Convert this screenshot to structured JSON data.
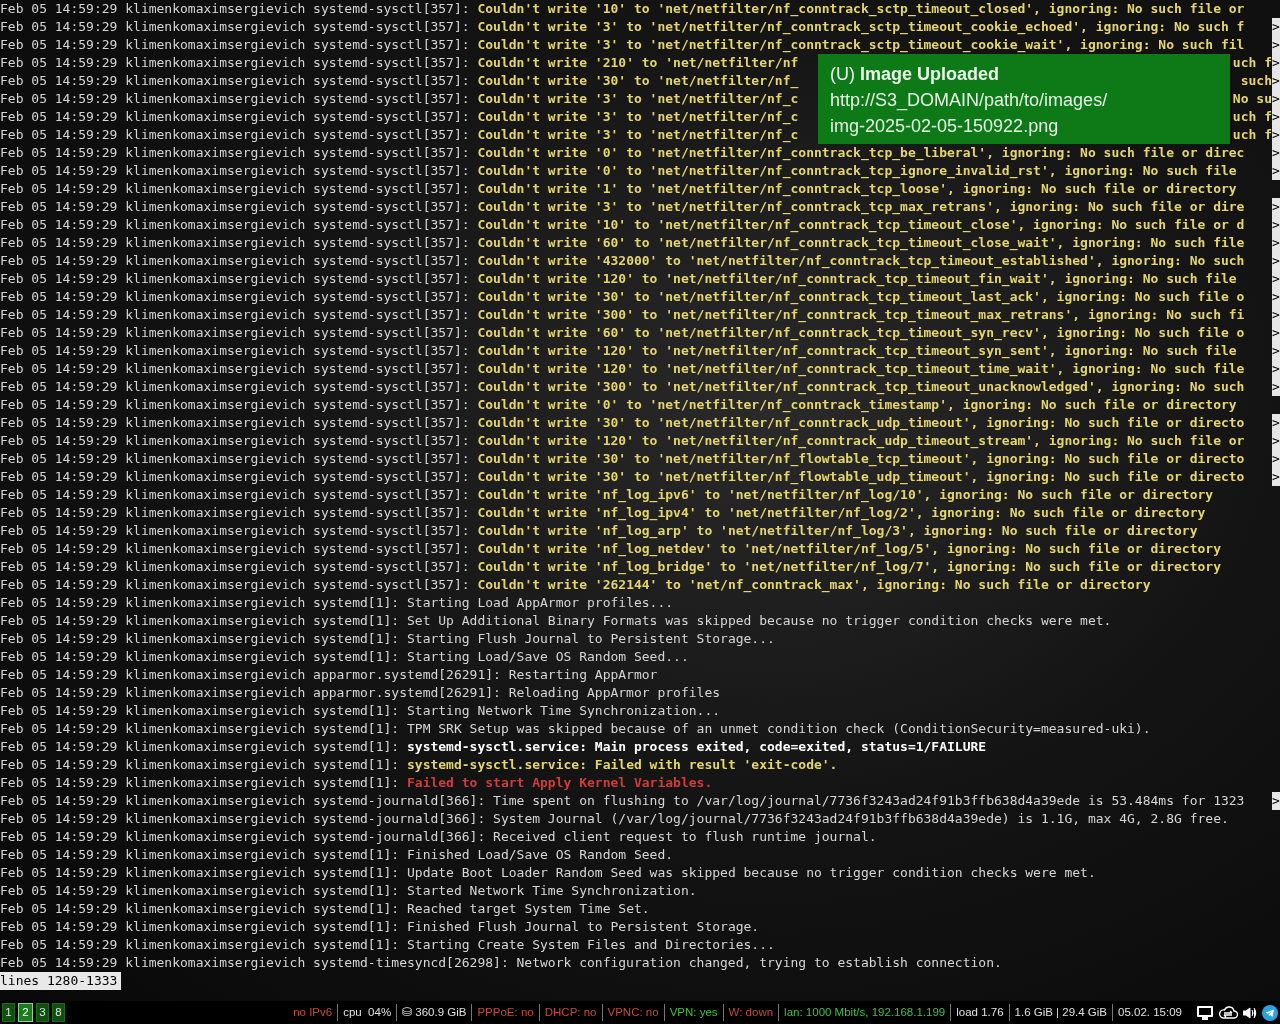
{
  "terminal": {
    "lines": [
      {
        "prefix": "Feb 05 14:59:29 klimenkomaximsergievich systemd-sysctl[357]:",
        "message": "Couldn't write '10' to 'net/netfilter/nf_conntrack_sctp_timeout_closed', ignoring: No such file or",
        "kind": "warning"
      },
      {
        "prefix": "Feb 05 14:59:29 klimenkomaximsergievich systemd-sysctl[357]:",
        "message": "Couldn't write '3' to 'net/netfilter/nf_conntrack_sctp_timeout_cookie_echoed', ignoring: No such f",
        "kind": "warning",
        "marker": ">"
      },
      {
        "prefix": "Feb 05 14:59:29 klimenkomaximsergievich systemd-sysctl[357]:",
        "message": "Couldn't write '3' to 'net/netfilter/nf_conntrack_sctp_timeout_cookie_wait', ignoring: No such fil",
        "kind": "warning",
        "marker": ">"
      },
      {
        "prefix": "Feb 05 14:59:29 klimenkomaximsergievich systemd-sysctl[357]:",
        "message": "Couldn't write '210' to 'net/netfilter/nf",
        "message_end": "uch f",
        "kind": "warning",
        "marker": ">"
      },
      {
        "prefix": "Feb 05 14:59:29 klimenkomaximsergievich systemd-sysctl[357]:",
        "message": "Couldn't write '30' to 'net/netfilter/nf_",
        "message_end": "such",
        "kind": "warning",
        "marker": ">"
      },
      {
        "prefix": "Feb 05 14:59:29 klimenkomaximsergievich systemd-sysctl[357]:",
        "message": "Couldn't write '3' to 'net/netfilter/nf_c",
        "message_end": "No su",
        "kind": "warning",
        "marker": ">"
      },
      {
        "prefix": "Feb 05 14:59:29 klimenkomaximsergievich systemd-sysctl[357]:",
        "message": "Couldn't write '3' to 'net/netfilter/nf_c",
        "message_end": "uch f",
        "kind": "warning",
        "marker": ">"
      },
      {
        "prefix": "Feb 05 14:59:29 klimenkomaximsergievich systemd-sysctl[357]:",
        "message": "Couldn't write '3' to 'net/netfilter/nf_c",
        "message_end": "uch f",
        "kind": "warning",
        "marker": ">"
      },
      {
        "prefix": "Feb 05 14:59:29 klimenkomaximsergievich systemd-sysctl[357]:",
        "message": "Couldn't write '0' to 'net/netfilter/nf_conntrack_tcp_be_liberal', ignoring: No such file or direc",
        "kind": "warning",
        "marker": ">"
      },
      {
        "prefix": "Feb 05 14:59:29 klimenkomaximsergievich systemd-sysctl[357]:",
        "message": "Couldn't write '0' to 'net/netfilter/nf_conntrack_tcp_ignore_invalid_rst', ignoring: No such file",
        "kind": "warning",
        "marker": ">"
      },
      {
        "prefix": "Feb 05 14:59:29 klimenkomaximsergievich systemd-sysctl[357]:",
        "message": "Couldn't write '1' to 'net/netfilter/nf_conntrack_tcp_loose', ignoring: No such file or directory",
        "kind": "warning"
      },
      {
        "prefix": "Feb 05 14:59:29 klimenkomaximsergievich systemd-sysctl[357]:",
        "message": "Couldn't write '3' to 'net/netfilter/nf_conntrack_tcp_max_retrans', ignoring: No such file or dire",
        "kind": "warning",
        "marker": ">"
      },
      {
        "prefix": "Feb 05 14:59:29 klimenkomaximsergievich systemd-sysctl[357]:",
        "message": "Couldn't write '10' to 'net/netfilter/nf_conntrack_tcp_timeout_close', ignoring: No such file or d",
        "kind": "warning",
        "marker": ">"
      },
      {
        "prefix": "Feb 05 14:59:29 klimenkomaximsergievich systemd-sysctl[357]:",
        "message": "Couldn't write '60' to 'net/netfilter/nf_conntrack_tcp_timeout_close_wait', ignoring: No such file",
        "kind": "warning",
        "marker": ">"
      },
      {
        "prefix": "Feb 05 14:59:29 klimenkomaximsergievich systemd-sysctl[357]:",
        "message": "Couldn't write '432000' to 'net/netfilter/nf_conntrack_tcp_timeout_established', ignoring: No such",
        "kind": "warning",
        "marker": ">"
      },
      {
        "prefix": "Feb 05 14:59:29 klimenkomaximsergievich systemd-sysctl[357]:",
        "message": "Couldn't write '120' to 'net/netfilter/nf_conntrack_tcp_timeout_fin_wait', ignoring: No such file",
        "kind": "warning",
        "marker": ">"
      },
      {
        "prefix": "Feb 05 14:59:29 klimenkomaximsergievich systemd-sysctl[357]:",
        "message": "Couldn't write '30' to 'net/netfilter/nf_conntrack_tcp_timeout_last_ack', ignoring: No such file o",
        "kind": "warning",
        "marker": ">"
      },
      {
        "prefix": "Feb 05 14:59:29 klimenkomaximsergievich systemd-sysctl[357]:",
        "message": "Couldn't write '300' to 'net/netfilter/nf_conntrack_tcp_timeout_max_retrans', ignoring: No such fi",
        "kind": "warning",
        "marker": ">"
      },
      {
        "prefix": "Feb 05 14:59:29 klimenkomaximsergievich systemd-sysctl[357]:",
        "message": "Couldn't write '60' to 'net/netfilter/nf_conntrack_tcp_timeout_syn_recv', ignoring: No such file o",
        "kind": "warning",
        "marker": ">"
      },
      {
        "prefix": "Feb 05 14:59:29 klimenkomaximsergievich systemd-sysctl[357]:",
        "message": "Couldn't write '120' to 'net/netfilter/nf_conntrack_tcp_timeout_syn_sent', ignoring: No such file",
        "kind": "warning",
        "marker": ">"
      },
      {
        "prefix": "Feb 05 14:59:29 klimenkomaximsergievich systemd-sysctl[357]:",
        "message": "Couldn't write '120' to 'net/netfilter/nf_conntrack_tcp_timeout_time_wait', ignoring: No such file",
        "kind": "warning",
        "marker": ">"
      },
      {
        "prefix": "Feb 05 14:59:29 klimenkomaximsergievich systemd-sysctl[357]:",
        "message": "Couldn't write '300' to 'net/netfilter/nf_conntrack_tcp_timeout_unacknowledged', ignoring: No such",
        "kind": "warning",
        "marker": ">"
      },
      {
        "prefix": "Feb 05 14:59:29 klimenkomaximsergievich systemd-sysctl[357]:",
        "message": "Couldn't write '0' to 'net/netfilter/nf_conntrack_timestamp', ignoring: No such file or directory",
        "kind": "warning"
      },
      {
        "prefix": "Feb 05 14:59:29 klimenkomaximsergievich systemd-sysctl[357]:",
        "message": "Couldn't write '30' to 'net/netfilter/nf_conntrack_udp_timeout', ignoring: No such file or directo",
        "kind": "warning",
        "marker": ">"
      },
      {
        "prefix": "Feb 05 14:59:29 klimenkomaximsergievich systemd-sysctl[357]:",
        "message": "Couldn't write '120' to 'net/netfilter/nf_conntrack_udp_timeout_stream', ignoring: No such file or",
        "kind": "warning",
        "marker": ">"
      },
      {
        "prefix": "Feb 05 14:59:29 klimenkomaximsergievich systemd-sysctl[357]:",
        "message": "Couldn't write '30' to 'net/netfilter/nf_flowtable_tcp_timeout', ignoring: No such file or directo",
        "kind": "warning",
        "marker": ">"
      },
      {
        "prefix": "Feb 05 14:59:29 klimenkomaximsergievich systemd-sysctl[357]:",
        "message": "Couldn't write '30' to 'net/netfilter/nf_flowtable_udp_timeout', ignoring: No such file or directo",
        "kind": "warning",
        "marker": ">"
      },
      {
        "prefix": "Feb 05 14:59:29 klimenkomaximsergievich systemd-sysctl[357]:",
        "message": "Couldn't write 'nf_log_ipv6' to 'net/netfilter/nf_log/10', ignoring: No such file or directory",
        "kind": "warning"
      },
      {
        "prefix": "Feb 05 14:59:29 klimenkomaximsergievich systemd-sysctl[357]:",
        "message": "Couldn't write 'nf_log_ipv4' to 'net/netfilter/nf_log/2', ignoring: No such file or directory",
        "kind": "warning"
      },
      {
        "prefix": "Feb 05 14:59:29 klimenkomaximsergievich systemd-sysctl[357]:",
        "message": "Couldn't write 'nf_log_arp' to 'net/netfilter/nf_log/3', ignoring: No such file or directory",
        "kind": "warning"
      },
      {
        "prefix": "Feb 05 14:59:29 klimenkomaximsergievich systemd-sysctl[357]:",
        "message": "Couldn't write 'nf_log_netdev' to 'net/netfilter/nf_log/5', ignoring: No such file or directory",
        "kind": "warning"
      },
      {
        "prefix": "Feb 05 14:59:29 klimenkomaximsergievich systemd-sysctl[357]:",
        "message": "Couldn't write 'nf_log_bridge' to 'net/netfilter/nf_log/7', ignoring: No such file or directory",
        "kind": "warning"
      },
      {
        "prefix": "Feb 05 14:59:29 klimenkomaximsergievich systemd-sysctl[357]:",
        "message": "Couldn't write '262144' to 'net/nf_conntrack_max', ignoring: No such file or directory",
        "kind": "warning"
      },
      {
        "prefix": "Feb 05 14:59:29 klimenkomaximsergievich systemd[1]:",
        "message": "Starting Load AppArmor profiles...",
        "kind": "info"
      },
      {
        "prefix": "Feb 05 14:59:29 klimenkomaximsergievich systemd[1]:",
        "message": "Set Up Additional Binary Formats was skipped because no trigger condition checks were met.",
        "kind": "info"
      },
      {
        "prefix": "Feb 05 14:59:29 klimenkomaximsergievich systemd[1]:",
        "message": "Starting Flush Journal to Persistent Storage...",
        "kind": "info"
      },
      {
        "prefix": "Feb 05 14:59:29 klimenkomaximsergievich systemd[1]:",
        "message": "Starting Load/Save OS Random Seed...",
        "kind": "info"
      },
      {
        "prefix": "Feb 05 14:59:29 klimenkomaximsergievich apparmor.systemd[26291]:",
        "message": "Restarting AppArmor",
        "kind": "info"
      },
      {
        "prefix": "Feb 05 14:59:29 klimenkomaximsergievich apparmor.systemd[26291]:",
        "message": "Reloading AppArmor profiles",
        "kind": "info"
      },
      {
        "prefix": "Feb 05 14:59:29 klimenkomaximsergievich systemd[1]:",
        "message": "Starting Network Time Synchronization...",
        "kind": "info"
      },
      {
        "prefix": "Feb 05 14:59:29 klimenkomaximsergievich systemd[1]:",
        "message": "TPM SRK Setup was skipped because of an unmet condition check (ConditionSecurity=measured-uki).",
        "kind": "info"
      },
      {
        "prefix": "Feb 05 14:59:29 klimenkomaximsergievich systemd[1]:",
        "message": "systemd-sysctl.service: Main process exited, code=exited, status=1/FAILURE",
        "kind": "notice"
      },
      {
        "prefix": "Feb 05 14:59:29 klimenkomaximsergievich systemd[1]:",
        "message": "systemd-sysctl.service: Failed with result 'exit-code'.",
        "kind": "warning"
      },
      {
        "prefix": "Feb 05 14:59:29 klimenkomaximsergievich systemd[1]:",
        "message": "Failed to start Apply Kernel Variables.",
        "kind": "error"
      },
      {
        "prefix": "Feb 05 14:59:29 klimenkomaximsergievich systemd-journald[366]:",
        "message": "Time spent on flushing to /var/log/journal/7736f3243ad24f91b3ffb638d4a39ede is 53.484ms for 1323",
        "kind": "info",
        "marker": ">"
      },
      {
        "prefix": "Feb 05 14:59:29 klimenkomaximsergievich systemd-journald[366]:",
        "message": "System Journal (/var/log/journal/7736f3243ad24f91b3ffb638d4a39ede) is 1.1G, max 4G, 2.8G free.",
        "kind": "info"
      },
      {
        "prefix": "Feb 05 14:59:29 klimenkomaximsergievich systemd-journald[366]:",
        "message": "Received client request to flush runtime journal.",
        "kind": "info"
      },
      {
        "prefix": "Feb 05 14:59:29 klimenkomaximsergievich systemd[1]:",
        "message": "Finished Load/Save OS Random Seed.",
        "kind": "info"
      },
      {
        "prefix": "Feb 05 14:59:29 klimenkomaximsergievich systemd[1]:",
        "message": "Update Boot Loader Random Seed was skipped because no trigger condition checks were met.",
        "kind": "info"
      },
      {
        "prefix": "Feb 05 14:59:29 klimenkomaximsergievich systemd[1]:",
        "message": "Started Network Time Synchronization.",
        "kind": "info"
      },
      {
        "prefix": "Feb 05 14:59:29 klimenkomaximsergievich systemd[1]:",
        "message": "Reached target System Time Set.",
        "kind": "info"
      },
      {
        "prefix": "Feb 05 14:59:29 klimenkomaximsergievich systemd[1]:",
        "message": "Finished Flush Journal to Persistent Storage.",
        "kind": "info"
      },
      {
        "prefix": "Feb 05 14:59:29 klimenkomaximsergievich systemd[1]:",
        "message": "Starting Create System Files and Directories...",
        "kind": "info"
      },
      {
        "prefix": "Feb 05 14:59:29 klimenkomaximsergievich systemd-timesyncd[26298]:",
        "message": "Network configuration changed, trying to establish connection.",
        "kind": "info"
      }
    ],
    "pager_status": "lines 1280-1333"
  },
  "notification": {
    "title": "(U) **Image Uploaded**",
    "body": [
      "http://S3_DOMAIN/path/to/images/",
      "img-2025-02-05-150922.png"
    ]
  },
  "status_bar": {
    "workspaces": [
      {
        "label": "1",
        "selected": false
      },
      {
        "label": "2",
        "selected": true
      },
      {
        "label": "3",
        "selected": false
      },
      {
        "label": "8",
        "selected": false
      }
    ],
    "items": [
      {
        "text": "no IPv6",
        "color": "#c84a3a"
      },
      {
        "text": "cpu  04%",
        "color": "#e0e0e0"
      },
      {
        "text": "⛁ 360.9 GiB",
        "color": "#e0e0e0"
      },
      {
        "text": "PPPoE: no",
        "color": "#c84a3a"
      },
      {
        "text": "DHCP: no",
        "color": "#c84a3a"
      },
      {
        "text": "VPNC: no",
        "color": "#c84a3a"
      },
      {
        "text": "VPN: yes",
        "color": "#3fc23f"
      },
      {
        "text": "W: down",
        "color": "#c84a3a"
      },
      {
        "text": "lan: 1000 Mbit/s, 192.168.1.199",
        "color": "#3fc23f"
      },
      {
        "text": "load 1.76",
        "color": "#e0e0e0"
      },
      {
        "text": "1.6 GiB | 29.4 GiB",
        "color": "#e0e0e0"
      },
      {
        "text": "05.02. 15:09",
        "color": "#e0e0e0"
      }
    ],
    "tray": [
      {
        "kind": "monitor"
      },
      {
        "kind": "cloud"
      },
      {
        "kind": "speaker"
      },
      {
        "kind": "plane"
      }
    ]
  }
}
